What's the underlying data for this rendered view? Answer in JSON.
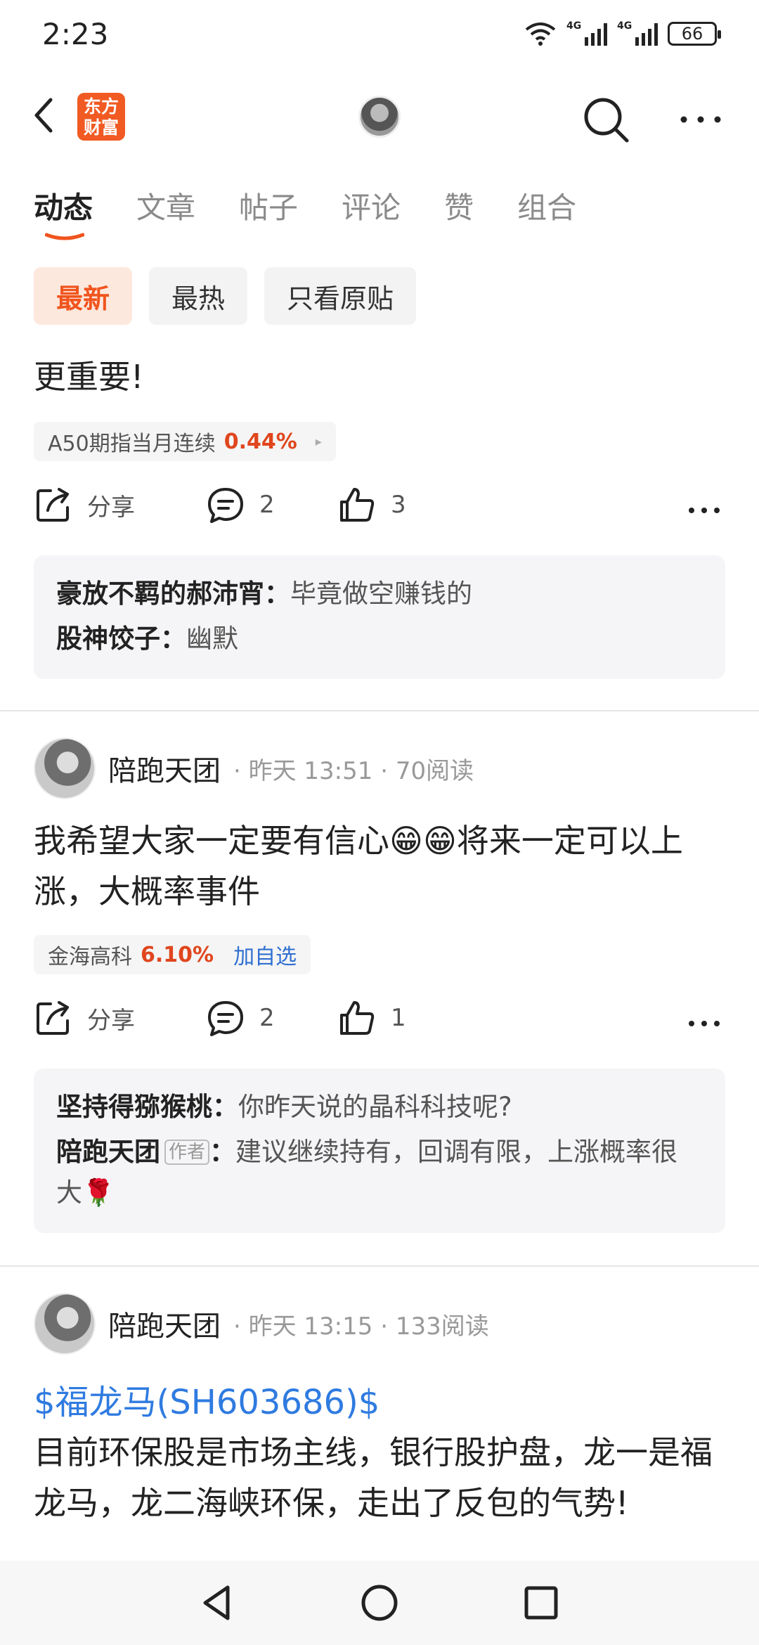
{
  "status": {
    "time": "2:23",
    "battery": "66",
    "net1": "4G",
    "net2": "4G"
  },
  "header": {
    "logo_line1": "东方",
    "logo_line2": "财富"
  },
  "tabs": [
    "动态",
    "文章",
    "帖子",
    "评论",
    "赞",
    "组合"
  ],
  "filters": [
    "最新",
    "最热",
    "只看原贴"
  ],
  "posts": [
    {
      "text": "更重要!",
      "stock": {
        "name": "A50期指当月连续",
        "pct": "0.44%",
        "arrow": "▸"
      },
      "share_label": "分享",
      "comment_count": "2",
      "like_count": "3",
      "comments": [
        {
          "who": "豪放不羁的郝沛宵",
          "text": "毕竟做空赚钱的"
        },
        {
          "who": "股神饺子",
          "text": "幽默"
        }
      ]
    },
    {
      "author": "陪跑天团",
      "meta": "· 昨天 13:51 · 70阅读",
      "text": "我希望大家一定要有信心😁😁将来一定可以上涨，大概率事件",
      "stock": {
        "name": "金海高科",
        "pct": "6.10%",
        "add": "加自选"
      },
      "share_label": "分享",
      "comment_count": "2",
      "like_count": "1",
      "comments": [
        {
          "who": "坚持得猕猴桃",
          "text": "你昨天说的晶科科技呢?"
        },
        {
          "who": "陪跑天团",
          "tag": "作者",
          "text": "建议继续持有，回调有限，上涨概率很大🌹"
        }
      ]
    },
    {
      "author": "陪跑天团",
      "meta": "· 昨天 13:15 · 133阅读",
      "stock_link": "$福龙马(SH603686)$",
      "text": "目前环保股是市场主线，银行股护盘，龙一是福龙马，龙二海峡环保，走出了反包的气势!"
    }
  ],
  "colors": {
    "accent": "#f0541e",
    "link": "#2f7be0",
    "rise": "#e0461d"
  }
}
